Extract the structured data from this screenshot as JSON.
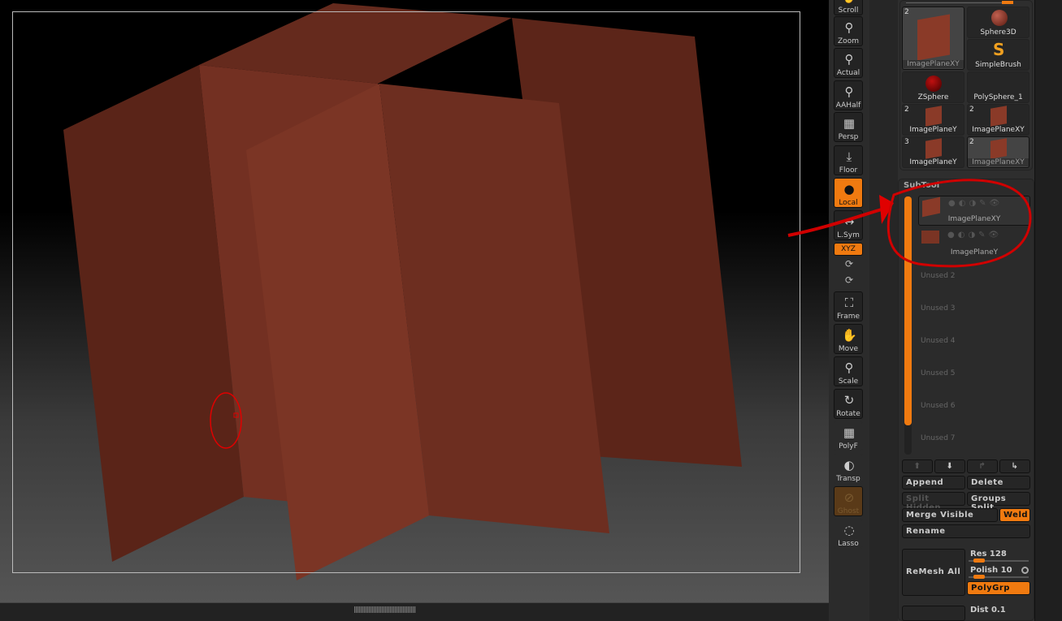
{
  "toolbar": [
    {
      "label": "Scroll",
      "icon": "scroll-icon"
    },
    {
      "label": "Zoom",
      "icon": "zoom-icon"
    },
    {
      "label": "Actual",
      "icon": "actual-icon"
    },
    {
      "label": "AAHalf",
      "icon": "aahalf-icon"
    },
    {
      "label": "Persp",
      "icon": "perspective-icon"
    },
    {
      "label": "Floor",
      "icon": "floor-icon"
    },
    {
      "label": "Local",
      "icon": "local-icon"
    },
    {
      "label": "L.Sym",
      "icon": "local-symmetry-icon"
    },
    {
      "label": "XYZ",
      "icon": "xyz-rotate-icon"
    },
    {
      "label": "Frame",
      "icon": "frame-icon"
    },
    {
      "label": "Move",
      "icon": "move-icon"
    },
    {
      "label": "Scale",
      "icon": "scale-icon"
    },
    {
      "label": "Rotate",
      "icon": "rotate-icon"
    },
    {
      "label": "PolyF",
      "icon": "polyframe-icon"
    },
    {
      "label": "Transp",
      "icon": "transparency-icon"
    },
    {
      "label": "Ghost",
      "icon": "ghost-icon"
    },
    {
      "label": "Lasso",
      "icon": "lasso-icon"
    }
  ],
  "tools": [
    {
      "label": "ImagePlaneXY",
      "count": "2"
    },
    {
      "label": "Sphere3D",
      "count": ""
    },
    {
      "label": "SimpleBrush",
      "count": ""
    },
    {
      "label": "ZSphere",
      "count": ""
    },
    {
      "label": "PolySphere_1",
      "count": ""
    },
    {
      "label": "ImagePlaneY",
      "count": "2"
    },
    {
      "label": "ImagePlaneXY",
      "count": "2"
    },
    {
      "label": "ImagePlaneY",
      "count": "3"
    },
    {
      "label": "ImagePlaneXY",
      "count": "2"
    }
  ],
  "subtool": {
    "title": "SubTool",
    "items": [
      "ImagePlaneXY",
      "ImagePlaneY",
      "Unused 2",
      "Unused 3",
      "Unused 4",
      "Unused 5",
      "Unused 6",
      "Unused 7"
    ],
    "buttons": {
      "append": "Append",
      "delete": "Delete",
      "split_hidden": "Split Hidden",
      "groups_split": "Groups Split",
      "merge_visible": "Merge Visible",
      "weld": "Weld",
      "rename": "Rename",
      "remesh_all": "ReMesh All",
      "polygrp": "PolyGrp"
    },
    "res_label": "Res 128",
    "res_value": 128,
    "polish_label": "Polish 10",
    "polish_value": 10,
    "dist_label": "Dist 0.1"
  },
  "colors": {
    "accent": "#f07a10",
    "annotation": "#e00000"
  }
}
